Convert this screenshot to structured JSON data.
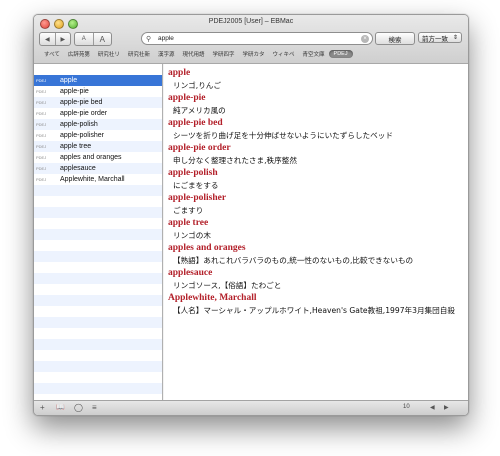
{
  "window": {
    "title": "PDEJ2005 [User] – EBMac"
  },
  "toolbar": {
    "back": "◀",
    "forward": "▶",
    "font_small": "A",
    "font_large": "A",
    "search_query": "apple",
    "search_button": "検索",
    "match_mode": "前方一致"
  },
  "tabs": [
    "すべて",
    "広辞苑第",
    "研究社リ",
    "研究社新",
    "漢字源",
    "現代用語",
    "学研四字",
    "学研カタ",
    "ウィキペ",
    "青空文庫",
    "PDEJ"
  ],
  "sidebar": {
    "items": [
      {
        "src": "PDEJ",
        "word": "apple"
      },
      {
        "src": "PDEJ",
        "word": "apple-pie"
      },
      {
        "src": "PDEJ",
        "word": "apple-pie bed"
      },
      {
        "src": "PDEJ",
        "word": "apple-pie order"
      },
      {
        "src": "PDEJ",
        "word": "apple-polish"
      },
      {
        "src": "PDEJ",
        "word": "apple-polisher"
      },
      {
        "src": "PDEJ",
        "word": "apple tree"
      },
      {
        "src": "PDEJ",
        "word": "apples and oranges"
      },
      {
        "src": "PDEJ",
        "word": "applesauce"
      },
      {
        "src": "PDEJ",
        "word": "Applewhite, Marchall"
      }
    ]
  },
  "content": {
    "entries": [
      {
        "headword": "apple",
        "definition": "リンゴ,りんご"
      },
      {
        "headword": "apple-pie",
        "definition": "純アメリカ風の"
      },
      {
        "headword": "apple-pie bed",
        "definition": "シーツを折り曲げ足を十分伸ばせないようにいたずらしたベッド"
      },
      {
        "headword": "apple-pie order",
        "definition": "申し分なく整理されたさま,秩序整然"
      },
      {
        "headword": "apple-polish",
        "definition": "にごまをする"
      },
      {
        "headword": "apple-polisher",
        "definition": "ごますり"
      },
      {
        "headword": "apple tree",
        "definition": "リンゴの木"
      },
      {
        "headword": "apples and oranges",
        "definition": "【熟語】あれこれバラバラのもの,統一性のないもの,比較できないもの"
      },
      {
        "headword": "applesauce",
        "definition": "リンゴソース,【俗語】たわごと"
      },
      {
        "headword": "Applewhite, Marchall",
        "definition": "【人名】マーシャル・アップルホワイト,Heaven's Gate教祖,1997年3月集団自殺"
      }
    ]
  },
  "bottombar": {
    "font_size": "10",
    "add": "+",
    "book": "📖",
    "circle": "◯",
    "list": "≡",
    "prev": "◀",
    "next": "▶"
  }
}
